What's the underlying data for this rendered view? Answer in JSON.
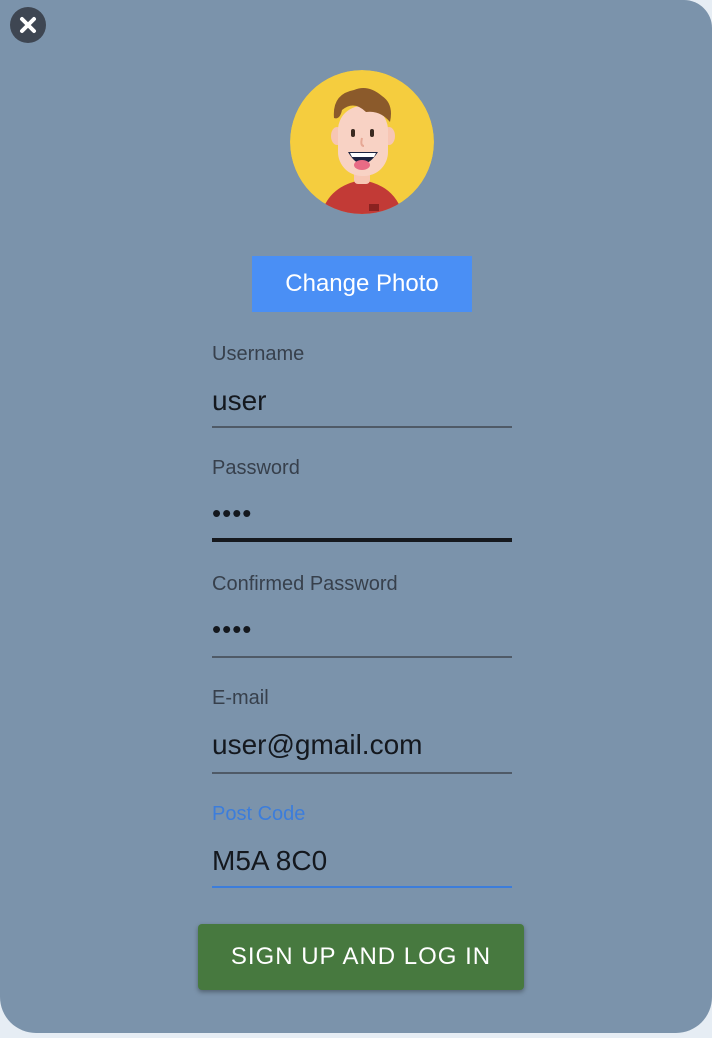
{
  "close_button": {
    "icon": "close-icon"
  },
  "avatar": {
    "icon": "user-avatar-icon",
    "background": "#f5cd3e"
  },
  "change_photo": {
    "label": "Change Photo",
    "color": "#4a8ff5"
  },
  "form": {
    "username": {
      "label": "Username",
      "value": "user"
    },
    "password": {
      "label": "Password",
      "value": "••••"
    },
    "confirmed_password": {
      "label": "Confirmed Password",
      "value": "••••"
    },
    "email": {
      "label": "E-mail",
      "value": "user@gmail.com"
    },
    "post_code": {
      "label": "Post Code",
      "value": "M5A 8C0"
    }
  },
  "submit": {
    "label": "SIGN UP AND LOG IN",
    "color": "#47793f"
  },
  "colors": {
    "panel_background": "#7b93ab",
    "active_field": "#3c7ddb"
  }
}
